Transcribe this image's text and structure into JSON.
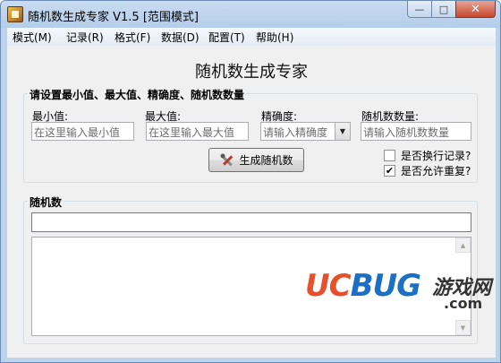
{
  "window": {
    "title": "随机数生成专家 V1.5 [范围模式]",
    "icon": "app-icon",
    "buttons": {
      "minimize": "—",
      "maximize": "□",
      "close": "✕"
    }
  },
  "menu": [
    "模式(M)",
    "记录(R)",
    "格式(F)",
    "数据(D)",
    "配置(T)",
    "帮助(H)"
  ],
  "main_title": "随机数生成专家",
  "settings": {
    "group_label": "请设置最小值、最大值、精确度、随机数数量",
    "min": {
      "label": "最小值:",
      "placeholder": "在这里输入最小值"
    },
    "max": {
      "label": "最大值:",
      "placeholder": "在这里输入最大值"
    },
    "precision": {
      "label": "精确度:",
      "placeholder": "请输入精确度"
    },
    "count": {
      "label": "随机数数量:",
      "placeholder": "请输入随机数数量"
    },
    "generate_button": "生成随机数",
    "options": [
      {
        "label": "是否换行记录?",
        "checked": false
      },
      {
        "label": "是否允许重复?",
        "checked": true
      }
    ]
  },
  "result": {
    "group_label": "随机数",
    "current_value": "",
    "log": ""
  },
  "watermark": {
    "brand_uc": "UC",
    "brand_bug": "BUG",
    "cn": "游戏网",
    "domain": ".com"
  },
  "colors": {
    "accent_red": "#e7502b",
    "accent_blue": "#1b6fc4",
    "titlebar": "#bcd3ec"
  }
}
